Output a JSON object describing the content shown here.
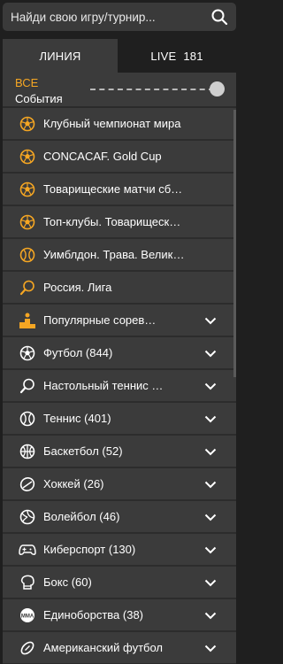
{
  "search": {
    "placeholder": "Найди свою игру/турнир..."
  },
  "tabs": [
    {
      "label": "ЛИНИЯ"
    },
    {
      "label": "LIVE",
      "count": "181"
    }
  ],
  "filter": {
    "all_label": "ВСЕ",
    "events_label": "События"
  },
  "favorites": [
    {
      "label": "Клубный чемпионат мира",
      "icon": "soccer-ball-icon"
    },
    {
      "label": "CONCACAF. Gold Cup",
      "icon": "soccer-ball-icon"
    },
    {
      "label": "Товарищеские матчи сборных",
      "icon": "soccer-ball-icon"
    },
    {
      "label": "Топ-клубы. Товарищеские матчи",
      "icon": "soccer-ball-icon"
    },
    {
      "label": "Уимблдон. Трава. Великобритания",
      "icon": "tennis-ball-icon"
    },
    {
      "label": "Россия. Лига",
      "icon": "table-tennis-icon"
    }
  ],
  "sports": [
    {
      "label": "Популярные соревнования",
      "icon": "podium-icon"
    },
    {
      "label": "Футбол (844)",
      "icon": "soccer-ball-icon"
    },
    {
      "label": "Настольный теннис (...)",
      "icon": "table-tennis-icon"
    },
    {
      "label": "Теннис (401)",
      "icon": "tennis-ball-icon"
    },
    {
      "label": "Баскетбол (52)",
      "icon": "basketball-icon"
    },
    {
      "label": "Хоккей (26)",
      "icon": "hockey-puck-icon"
    },
    {
      "label": "Волейбол (46)",
      "icon": "volleyball-icon"
    },
    {
      "label": "Киберспорт (130)",
      "icon": "gamepad-icon"
    },
    {
      "label": "Бокс (60)",
      "icon": "boxing-glove-icon"
    },
    {
      "label": "Единоборства (38)",
      "icon": "mma-icon"
    },
    {
      "label": "Американский футбол",
      "icon": "american-football-icon"
    }
  ],
  "colors": {
    "accent": "#f5a623",
    "row_bg": "#3b3b3b",
    "page_bg": "#1f1f1f",
    "icon_white": "#ffffff"
  }
}
